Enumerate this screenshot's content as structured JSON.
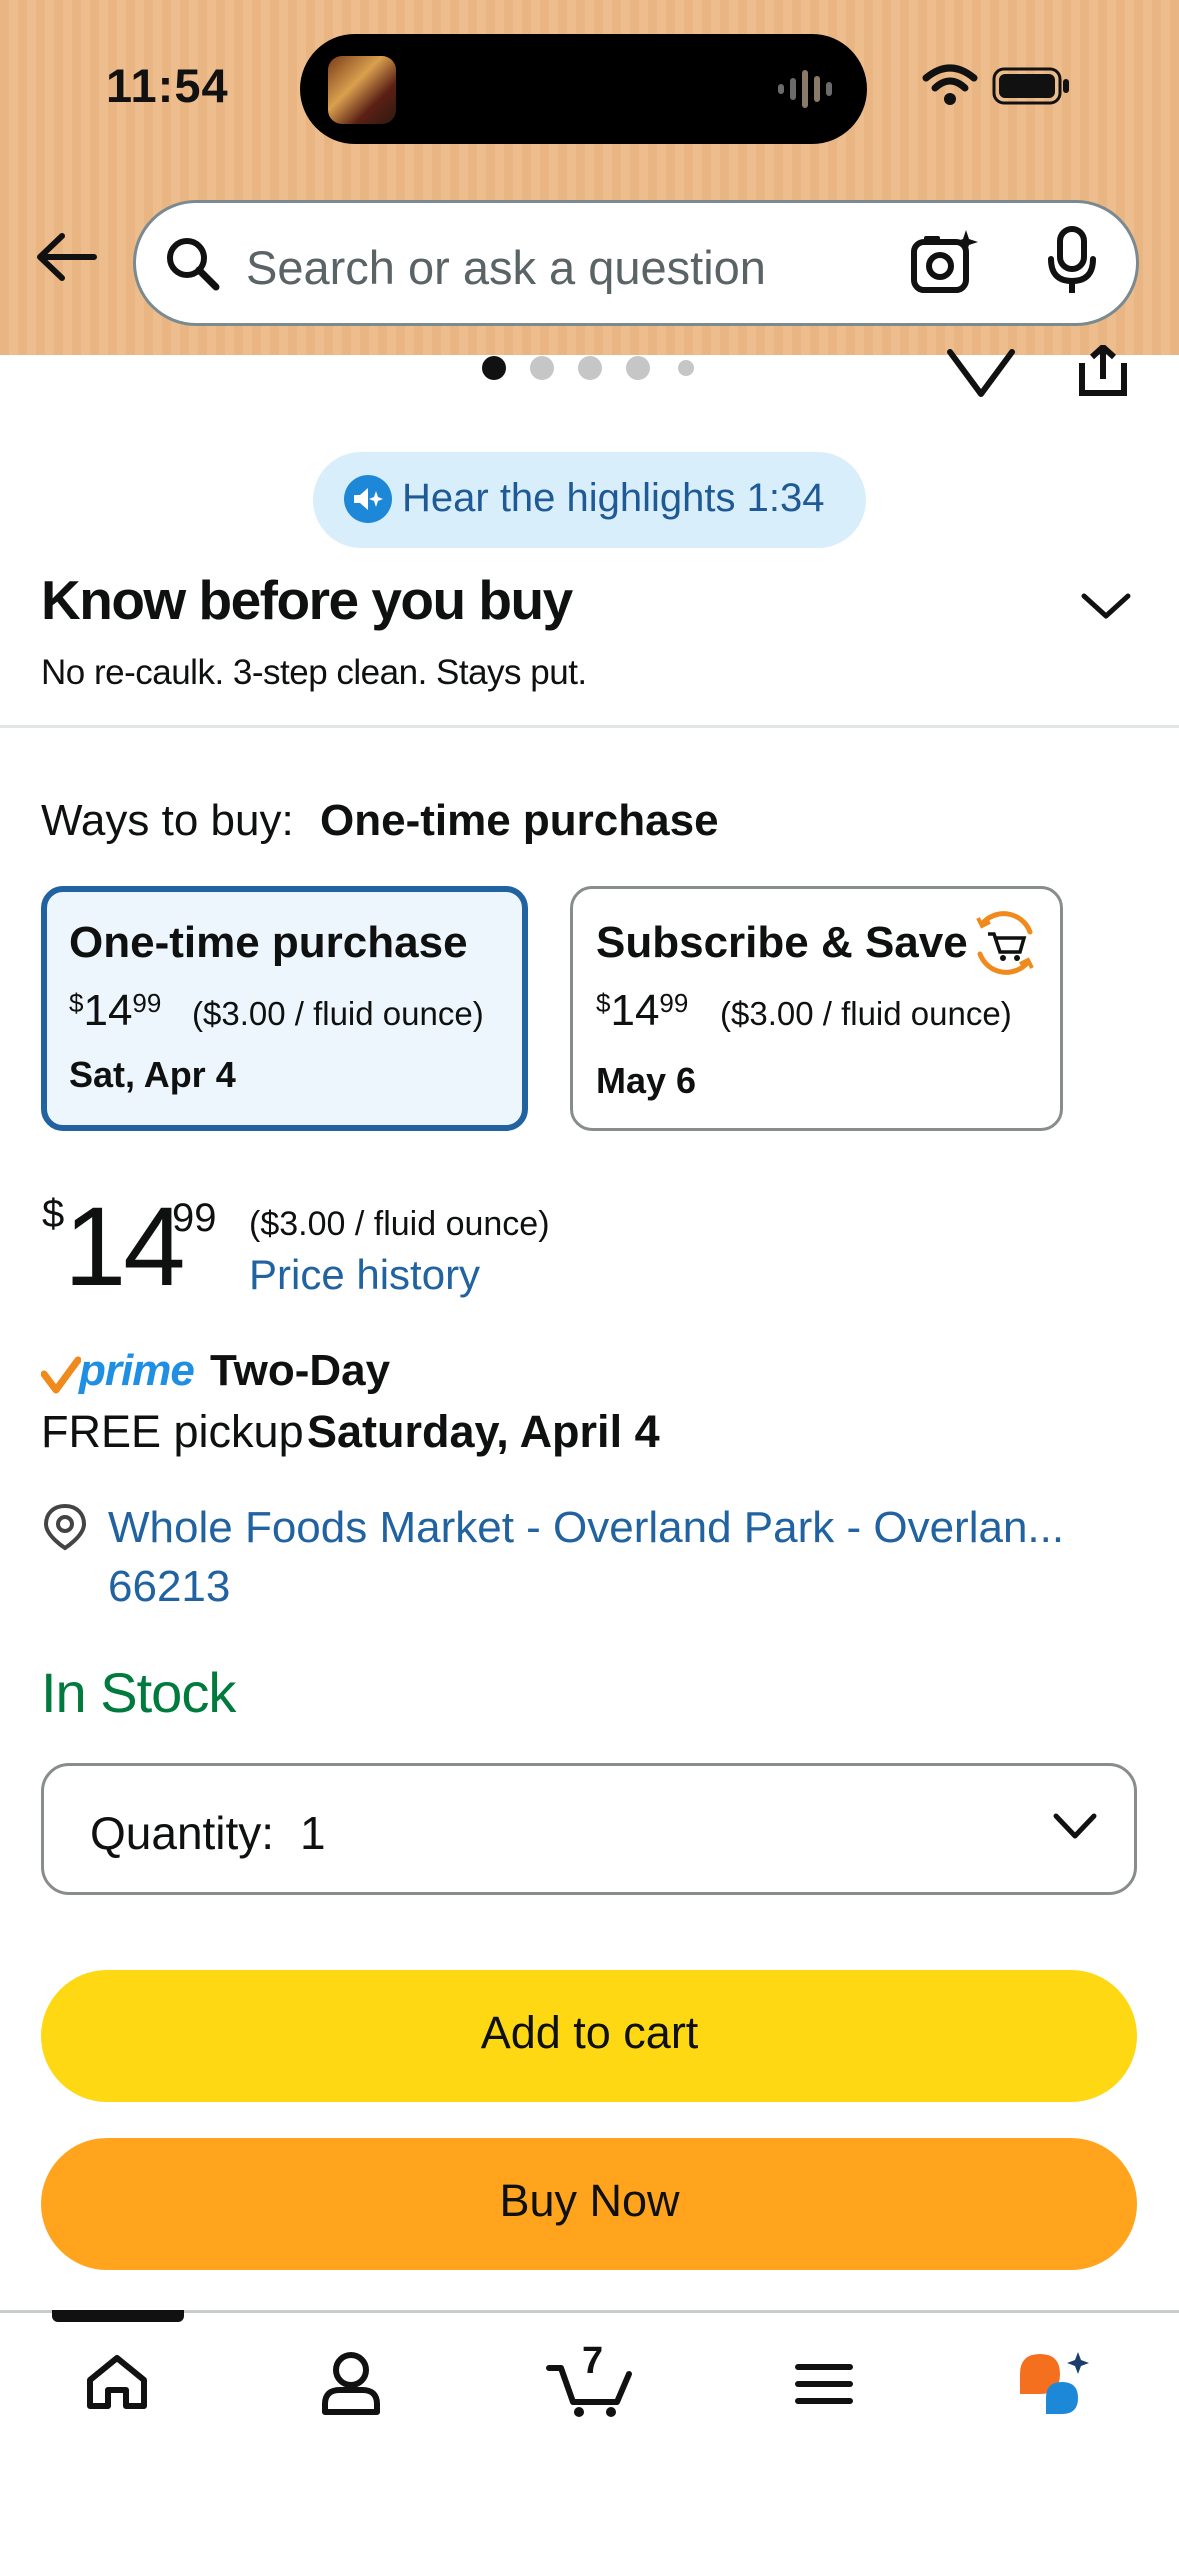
{
  "status_bar": {
    "time": "11:54"
  },
  "search": {
    "placeholder": "Search or ask a question"
  },
  "gallery": {
    "dots_total": 5,
    "dot_active_index": 0
  },
  "highlights": {
    "label": "Hear the highlights 1:34"
  },
  "know_before": {
    "title": "Know before you buy",
    "subtitle": "No re-caulk. 3-step clean. Stays put."
  },
  "ways_to_buy": {
    "label": "Ways to buy:",
    "selected": "One-time purchase",
    "options": [
      {
        "title": "One-time purchase",
        "price_symbol": "$",
        "price_whole": "14",
        "price_cents": "99",
        "unit_price": "($3.00 / fluid ounce)",
        "date": "Sat, Apr 4",
        "selected": true
      },
      {
        "title": "Subscribe & Save",
        "price_symbol": "$",
        "price_whole": "14",
        "price_cents": "99",
        "unit_price": "($3.00 / fluid ounce)",
        "date": "May 6",
        "selected": false,
        "icon": "subscribe-cart-icon"
      }
    ]
  },
  "price": {
    "symbol": "$",
    "whole": "14",
    "cents": "99",
    "unit_price": "($3.00 / fluid ounce)",
    "history_link": "Price history"
  },
  "delivery": {
    "prime_word": "prime",
    "speed": "Two-Day",
    "pickup_prefix": "FREE pickup",
    "pickup_date": "Saturday, April 4"
  },
  "store": {
    "line1": "Whole Foods Market - Overland Park - Overlan...",
    "line2": "66213"
  },
  "stock": {
    "status": "In Stock"
  },
  "quantity": {
    "label": "Quantity:",
    "value": "1"
  },
  "actions": {
    "add_to_cart": "Add to cart",
    "buy_now": "Buy Now"
  },
  "tab_bar": {
    "items": [
      "home-icon",
      "account-icon",
      "cart-icon",
      "menu-icon",
      "rufus-ai-icon"
    ],
    "cart_count": "7",
    "active_index": 0
  },
  "colors": {
    "header_bg": "#e9b583",
    "link": "#2162a1",
    "in_stock": "#007a3d",
    "add_to_cart": "#ffd814",
    "buy_now": "#ffa41c",
    "prime_blue": "#1f8fe3",
    "selected_card_border": "#2162a1"
  }
}
